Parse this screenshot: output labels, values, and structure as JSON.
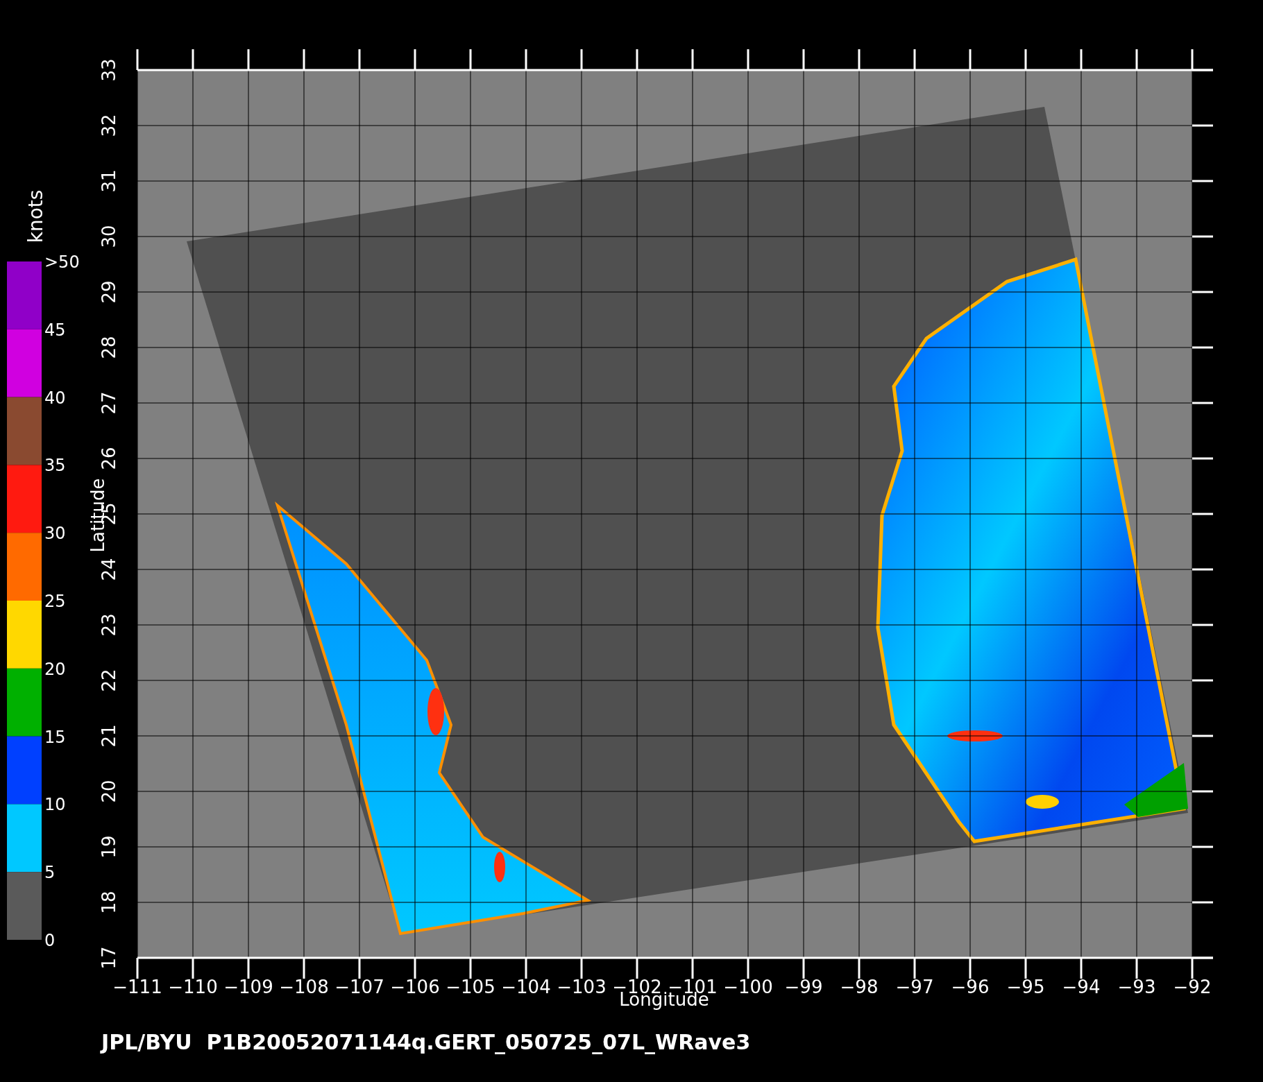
{
  "plot": {
    "xlabel": "Longitude",
    "ylabel": "Latitude",
    "xticks": [
      "−111",
      "−110",
      "−109",
      "−108",
      "−107",
      "−106",
      "−105",
      "−104",
      "−103",
      "−102",
      "−101",
      "−100",
      "−99",
      "−98",
      "−97",
      "−96",
      "−95",
      "−94",
      "−93",
      "−92"
    ],
    "yticks": [
      "17",
      "18",
      "19",
      "20",
      "21",
      "22",
      "23",
      "24",
      "25",
      "26",
      "27",
      "28",
      "29",
      "30",
      "31",
      "32",
      "33"
    ]
  },
  "colorbar": {
    "title": "knots",
    "labels": [
      ">50",
      "45",
      "40",
      "35",
      "30",
      "25",
      "20",
      "15",
      "10",
      "5",
      "0"
    ],
    "segments": [
      {
        "color": "#9000c8"
      },
      {
        "color": "#d000e0"
      },
      {
        "color": "#8a4a30"
      },
      {
        "color": "#ff1a10"
      },
      {
        "color": "#ff6a00"
      },
      {
        "color": "#ffd800"
      },
      {
        "color": "#00b000"
      },
      {
        "color": "#0040ff"
      },
      {
        "color": "#00c8ff"
      },
      {
        "color": "#5a5a5a"
      }
    ]
  },
  "caption": "JPL/BYU  P1B20052071144q.GERT_050725_07L_WRave3"
}
